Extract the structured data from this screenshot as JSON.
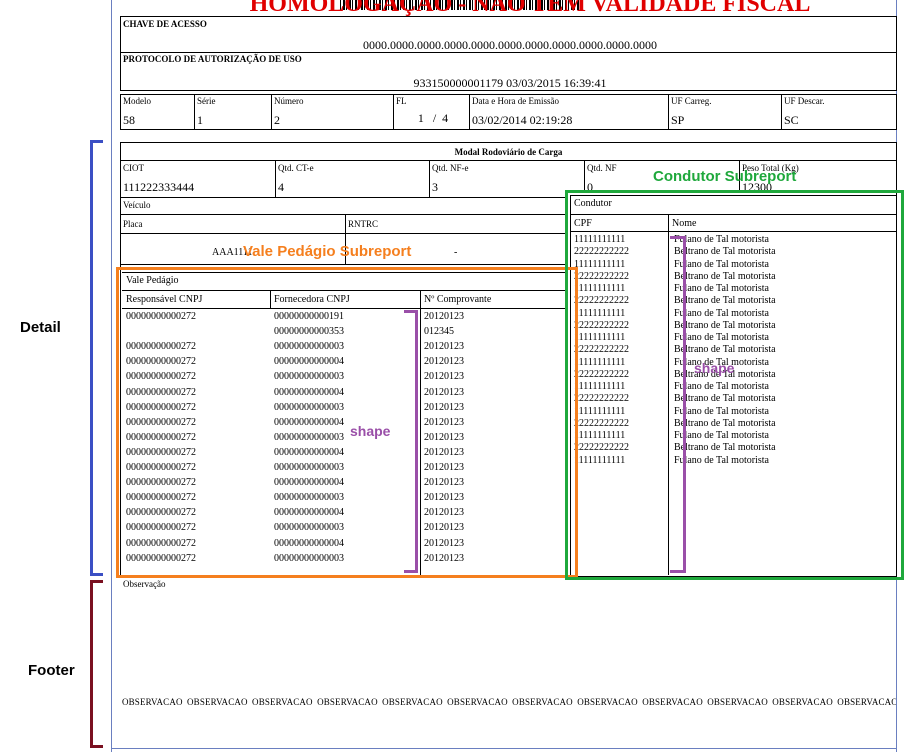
{
  "colors": {
    "banner_red": "#e00000",
    "detail_blue": "#3b4fc4",
    "footer_darkred": "#7a1020",
    "vale_orange": "#f57f1e",
    "condutor_green": "#1fa83c",
    "shape_purple": "#9a4fa8"
  },
  "header": {
    "banner": "HOMOLOGAÇÃO - NÃO TEM VALIDADE FISCAL",
    "chave_label": "CHAVE DE ACESSO",
    "chave_value": "0000.0000.0000.0000.0000.0000.0000.0000.0000.0000.0000",
    "protocolo_label": "PROTOCOLO DE AUTORIZAÇÃO DE USO",
    "protocolo_value": "933150000001179 03/03/2015 16:39:41"
  },
  "doc_info": {
    "modelo_label": "Modelo",
    "modelo_value": "58",
    "serie_label": "Série",
    "serie_value": "1",
    "numero_label": "Número",
    "numero_value": "2",
    "fl_label": "FL",
    "fl_value": "1   /  4",
    "data_label": "Data e Hora de Emissão",
    "data_value": "03/02/2014 02:19:28",
    "ufcarreg_label": "UF Carreg.",
    "ufcarreg_value": "SP",
    "ufdescar_label": "UF Descar.",
    "ufdescar_value": "SC"
  },
  "modal": {
    "title": "Modal Rodoviário de Carga",
    "ciot_label": "CIOT",
    "ciot_value": "111222333444",
    "qtdcte_label": "Qtd. CT-e",
    "qtdcte_value": "4",
    "qtdnfe_label": "Qtd. NF-e",
    "qtdnfe_value": "3",
    "qtdnf_label": "Qtd. NF",
    "qtdnf_value": "0",
    "peso_label": "Peso Total (Kg)",
    "peso_value": "12300",
    "veiculo_label": "Veículo",
    "placa_label": "Placa",
    "placa_value": "AAA1111",
    "rntrc_label": "RNTRC",
    "rntrc_value": "-"
  },
  "vale_pedagio": {
    "title": "Vale Pedágio",
    "columns": [
      "Responsável CNPJ",
      "Fornecedora CNPJ",
      "Nº Comprovante"
    ],
    "rows": [
      [
        "00000000000272",
        "00000000000191",
        "20120123"
      ],
      [
        "",
        "00000000000353",
        "012345"
      ],
      [
        "00000000000272",
        "00000000000003",
        "20120123"
      ],
      [
        "00000000000272",
        "00000000000004",
        "20120123"
      ],
      [
        "00000000000272",
        "00000000000003",
        "20120123"
      ],
      [
        "00000000000272",
        "00000000000004",
        "20120123"
      ],
      [
        "00000000000272",
        "00000000000003",
        "20120123"
      ],
      [
        "00000000000272",
        "00000000000004",
        "20120123"
      ],
      [
        "00000000000272",
        "00000000000003",
        "20120123"
      ],
      [
        "00000000000272",
        "00000000000004",
        "20120123"
      ],
      [
        "00000000000272",
        "00000000000003",
        "20120123"
      ],
      [
        "00000000000272",
        "00000000000004",
        "20120123"
      ],
      [
        "00000000000272",
        "00000000000003",
        "20120123"
      ],
      [
        "00000000000272",
        "00000000000004",
        "20120123"
      ],
      [
        "00000000000272",
        "00000000000003",
        "20120123"
      ],
      [
        "00000000000272",
        "00000000000004",
        "20120123"
      ],
      [
        "00000000000272",
        "00000000000003",
        "20120123"
      ]
    ]
  },
  "condutor": {
    "title": "Condutor",
    "cpf_label": "CPF",
    "nome_label": "Nome",
    "rows": [
      [
        "11111111111",
        "Fulano de Tal motorista"
      ],
      [
        "22222222222",
        "Beltrano de Tal motorista"
      ],
      [
        "11111111111",
        "Fulano de Tal motorista"
      ],
      [
        "22222222222",
        "Beltrano de Tal motorista"
      ],
      [
        "11111111111",
        "Fulano de Tal motorista"
      ],
      [
        "22222222222",
        "Beltrano de Tal motorista"
      ],
      [
        "11111111111",
        "Fulano de Tal motorista"
      ],
      [
        "22222222222",
        "Beltrano de Tal motorista"
      ],
      [
        "11111111111",
        "Fulano de Tal motorista"
      ],
      [
        "22222222222",
        "Beltrano de Tal motorista"
      ],
      [
        "11111111111",
        "Fulano de Tal motorista"
      ],
      [
        "22222222222",
        "Beltrano de Tal motorista"
      ],
      [
        "11111111111",
        "Fulano de Tal motorista"
      ],
      [
        "22222222222",
        "Beltrano de Tal motorista"
      ],
      [
        "11111111111",
        "Fulano de Tal motorista"
      ],
      [
        "22222222222",
        "Beltrano de Tal motorista"
      ],
      [
        "11111111111",
        "Fulano de Tal motorista"
      ],
      [
        "22222222222",
        "Beltrano de Tal motorista"
      ],
      [
        "11111111111",
        "Fulano de Tal motorista"
      ]
    ]
  },
  "footer": {
    "obs_label": "Observação",
    "obs_text": "OBSERVACAO OBSERVACAO OBSERVACAO OBSERVACAO OBSERVACAO OBSERVACAO OBSERVACAO OBSERVACAO OBSERVACAO OBSERVACAO OBSERVACAO OBSERVACAO OBSERVACAO OBSERVACAO OBSERV"
  },
  "annotations": {
    "detail": "Detail",
    "footer": "Footer",
    "vale_subreport": "Vale Pedágio Subreport",
    "condutor_subreport": "Condutor Subreport",
    "shape_left": "shape",
    "shape_right": "shape"
  }
}
